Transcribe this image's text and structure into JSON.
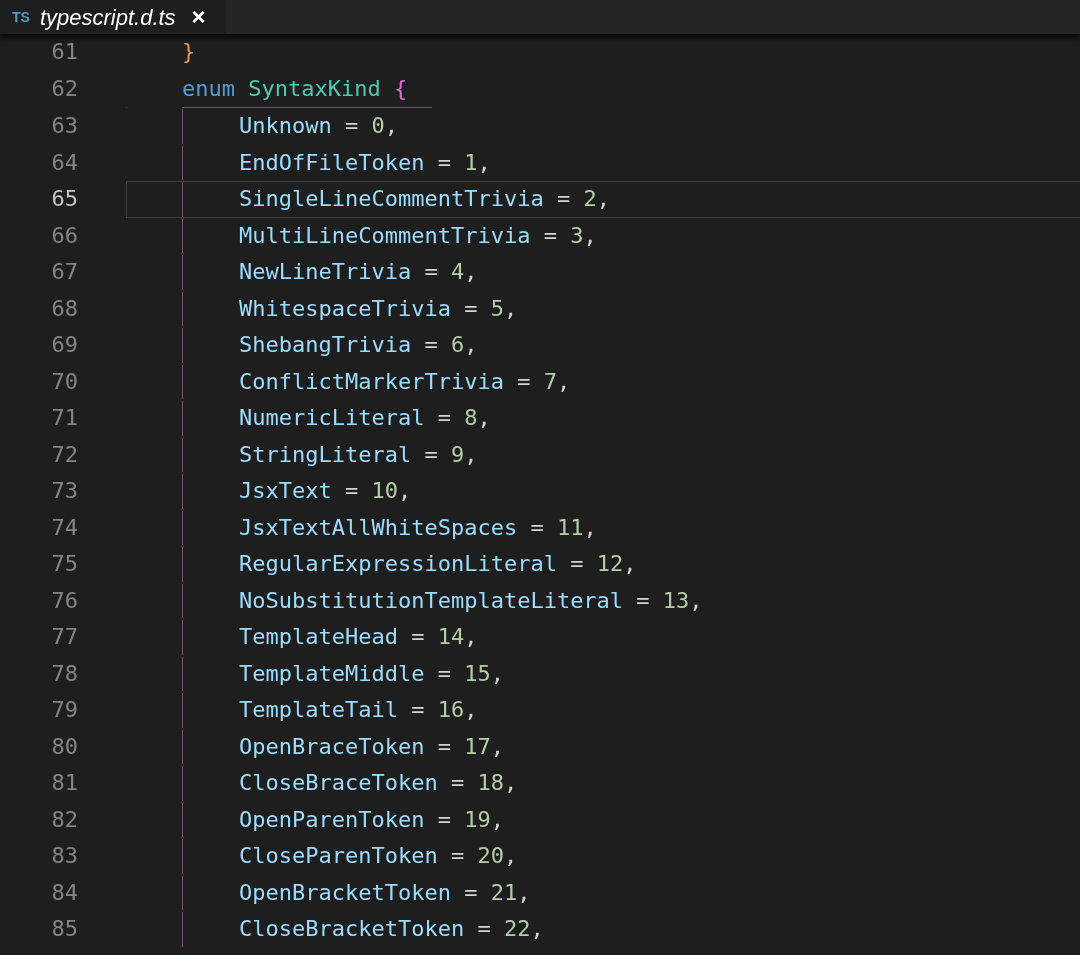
{
  "tab": {
    "badge": "TS",
    "title": "typescript.d.ts",
    "close": "×",
    "selected": true
  },
  "before": [
    {
      "number": "61",
      "kind": "close",
      "text": "}",
      "current": false
    },
    {
      "number": "62",
      "kind": "enum",
      "keyword": "enum",
      "name": "SyntaxKind",
      "brace": "{",
      "current": false
    }
  ],
  "members": [
    {
      "number": "63",
      "name": "Unknown",
      "equals": "=",
      "value": "0",
      "comma": ",",
      "current": false
    },
    {
      "number": "64",
      "name": "EndOfFileToken",
      "equals": "=",
      "value": "1",
      "comma": ",",
      "current": false
    },
    {
      "number": "65",
      "name": "SingleLineCommentTrivia",
      "equals": "=",
      "value": "2",
      "comma": ",",
      "current": true
    },
    {
      "number": "66",
      "name": "MultiLineCommentTrivia",
      "equals": "=",
      "value": "3",
      "comma": ",",
      "current": false
    },
    {
      "number": "67",
      "name": "NewLineTrivia",
      "equals": "=",
      "value": "4",
      "comma": ",",
      "current": false
    },
    {
      "number": "68",
      "name": "WhitespaceTrivia",
      "equals": "=",
      "value": "5",
      "comma": ",",
      "current": false
    },
    {
      "number": "69",
      "name": "ShebangTrivia",
      "equals": "=",
      "value": "6",
      "comma": ",",
      "current": false
    },
    {
      "number": "70",
      "name": "ConflictMarkerTrivia",
      "equals": "=",
      "value": "7",
      "comma": ",",
      "current": false
    },
    {
      "number": "71",
      "name": "NumericLiteral",
      "equals": "=",
      "value": "8",
      "comma": ",",
      "current": false
    },
    {
      "number": "72",
      "name": "StringLiteral",
      "equals": "=",
      "value": "9",
      "comma": ",",
      "current": false
    },
    {
      "number": "73",
      "name": "JsxText",
      "equals": "=",
      "value": "10",
      "comma": ",",
      "current": false
    },
    {
      "number": "74",
      "name": "JsxTextAllWhiteSpaces",
      "equals": "=",
      "value": "11",
      "comma": ",",
      "current": false
    },
    {
      "number": "75",
      "name": "RegularExpressionLiteral",
      "equals": "=",
      "value": "12",
      "comma": ",",
      "current": false
    },
    {
      "number": "76",
      "name": "NoSubstitutionTemplateLiteral",
      "equals": "=",
      "value": "13",
      "comma": ",",
      "current": false
    },
    {
      "number": "77",
      "name": "TemplateHead",
      "equals": "=",
      "value": "14",
      "comma": ",",
      "current": false
    },
    {
      "number": "78",
      "name": "TemplateMiddle",
      "equals": "=",
      "value": "15",
      "comma": ",",
      "current": false
    },
    {
      "number": "79",
      "name": "TemplateTail",
      "equals": "=",
      "value": "16",
      "comma": ",",
      "current": false
    },
    {
      "number": "80",
      "name": "OpenBraceToken",
      "equals": "=",
      "value": "17",
      "comma": ",",
      "current": false
    },
    {
      "number": "81",
      "name": "CloseBraceToken",
      "equals": "=",
      "value": "18",
      "comma": ",",
      "current": false
    },
    {
      "number": "82",
      "name": "OpenParenToken",
      "equals": "=",
      "value": "19",
      "comma": ",",
      "current": false
    },
    {
      "number": "83",
      "name": "CloseParenToken",
      "equals": "=",
      "value": "20",
      "comma": ",",
      "current": false
    },
    {
      "number": "84",
      "name": "OpenBracketToken",
      "equals": "=",
      "value": "21",
      "comma": ",",
      "current": false
    },
    {
      "number": "85",
      "name": "CloseBracketToken",
      "equals": "=",
      "value": "22",
      "comma": ",",
      "current": false
    }
  ]
}
